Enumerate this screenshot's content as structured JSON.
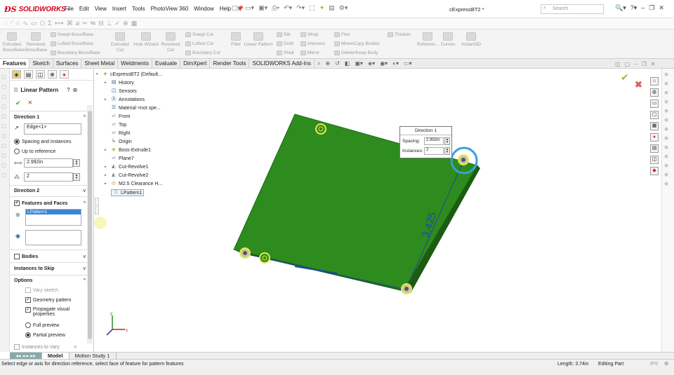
{
  "app": {
    "brand": "SOLIDWORKS",
    "doc_title": "cExpressBT2 *",
    "search_placeholder": "Search"
  },
  "menus": [
    "File",
    "Edit",
    "View",
    "Insert",
    "Tools",
    "PhotoView 360",
    "Window",
    "Help"
  ],
  "ribbon": {
    "extruded_bossbase": "Extruded Boss/Base",
    "revolved_bossbase": "Revolved Boss/Base",
    "swept_bossbase": "Swept Boss/Base",
    "lofted_bossbase": "Lofted Boss/Base",
    "boundary_bossbase": "Boundary Boss/Base",
    "extruded_cut": "Extruded Cut",
    "hole_wizard": "Hole Wizard",
    "revolved_cut": "Revolved Cut",
    "swept_cut": "Swept Cut",
    "lofted_cut": "Lofted Cut",
    "boundary_cut": "Boundary Cut",
    "fillet": "Fillet",
    "linear_pattern": "Linear Pattern",
    "rib": "Rib",
    "draft": "Draft",
    "shell": "Shell",
    "wrap": "Wrap",
    "intersect": "Intersect",
    "mirror": "Mirror",
    "flex": "Flex",
    "move_copy_bodies": "Move/Copy Bodies",
    "delete_keep_body": "Delete/Keep Body",
    "thicken": "Thicken",
    "reference": "Referenc...",
    "curves": "Curves",
    "instant3d": "Instant3D"
  },
  "tabs": [
    "Features",
    "Sketch",
    "Surfaces",
    "Sheet Metal",
    "Weldments",
    "Evaluate",
    "DimXpert",
    "Render Tools",
    "SOLIDWORKS Add-Ins"
  ],
  "property_manager": {
    "title": "Linear Pattern",
    "direction1": {
      "label": "Direction 1",
      "reference": "Edge<1>",
      "mode_spacing": "Spacing and instances",
      "mode_reference": "Up to reference",
      "spacing": "2.992in",
      "instances": "2"
    },
    "direction2": {
      "label": "Direction 2"
    },
    "features_faces": {
      "label": "Features and Faces",
      "selected": "LPattern1"
    },
    "bodies": "Bodies",
    "instances_to_skip": "Instances to Skip",
    "options": {
      "label": "Options",
      "vary_sketch": "Vary sketch",
      "geometry_pattern": "Geometry pattern",
      "propagate_visual": "Propagate visual properties",
      "full_preview": "Full preview",
      "partial_preview": "Partial preview"
    },
    "instances_to_vary": "Instances to Vary"
  },
  "tree": {
    "root": "cExpressBT2 (Default...",
    "items": [
      "History",
      "Sensors",
      "Annotations",
      "Material <not spe...",
      "Front",
      "Top",
      "Right",
      "Origin",
      "Boss-Extrude1",
      "Plane7",
      "Cut-Revolve1",
      "Cut-Revolve2",
      "M2.5 Clearance H...",
      "LPattern1"
    ]
  },
  "callout": {
    "title": "Direction 1",
    "spacing_label": "Spacing:",
    "spacing_value": "2.992in",
    "instances_label": "Instances:",
    "instances_value": "2"
  },
  "dimension": "3.425",
  "bottom_tabs": [
    "Model",
    "Motion Study 1"
  ],
  "status": {
    "message": "Select edge or axis for direction reference, select face of feature for pattern features",
    "length": "Length: 3.74in",
    "mode": "Editing Part",
    "units": "IPS"
  },
  "colors": {
    "brand_red": "#d6001c",
    "board_green": "#2e8b1e",
    "highlight_yellow": "#e8e84a",
    "selection_blue": "#3aa0d8"
  }
}
